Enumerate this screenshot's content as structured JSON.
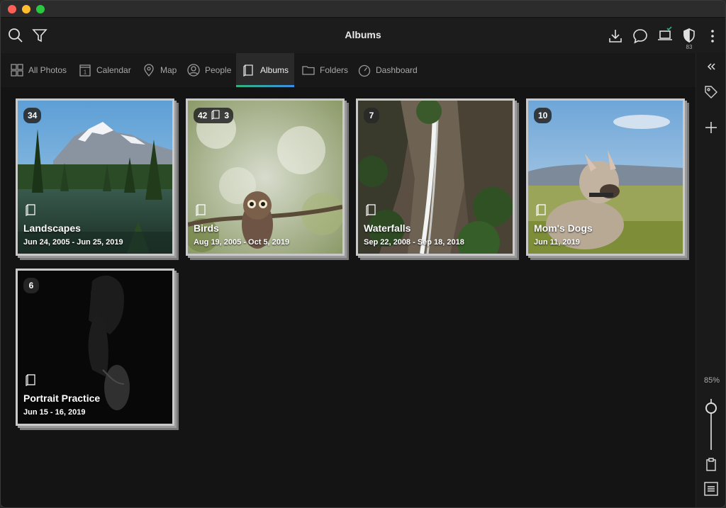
{
  "window": {
    "title": "Albums"
  },
  "toolbar": {
    "icons": [
      "search-icon",
      "filter-icon",
      "download-icon",
      "chat-icon",
      "laptop-icon",
      "shield-icon",
      "more-vertical-icon"
    ],
    "shield_count": "83"
  },
  "tabs": [
    {
      "label": "All Photos",
      "icon": "grid-icon"
    },
    {
      "label": "Calendar",
      "icon": "calendar-icon"
    },
    {
      "label": "Map",
      "icon": "map-pin-icon"
    },
    {
      "label": "People",
      "icon": "person-icon"
    },
    {
      "label": "Albums",
      "icon": "album-icon",
      "active": true
    },
    {
      "label": "Folders",
      "icon": "folder-icon"
    },
    {
      "label": "Dashboard",
      "icon": "gauge-icon"
    }
  ],
  "albums": [
    {
      "name": "Landscapes",
      "dates": "Jun 24, 2005 - Jun 25, 2019",
      "count": "34"
    },
    {
      "name": "Birds",
      "dates": "Aug 19, 2005 - Oct 5, 2019",
      "count": "42",
      "sub_count": "3"
    },
    {
      "name": "Waterfalls",
      "dates": "Sep 22, 2008 - Sep 18, 2018",
      "count": "7"
    },
    {
      "name": "Mom's Dogs",
      "dates": "Jun 11, 2019",
      "count": "10"
    },
    {
      "name": "Portrait Practice",
      "dates": "Jun 15 - 16, 2019",
      "count": "6"
    }
  ],
  "sidebar": {
    "zoom_label": "85%",
    "zoom_level": 0.85,
    "icons": [
      "collapse-icon",
      "tag-icon",
      "plus-icon",
      "clipboard-icon",
      "list-icon"
    ]
  },
  "colors": {
    "accent_start": "#2fb47a",
    "accent_end": "#3b8ee8",
    "background": "#141414"
  }
}
